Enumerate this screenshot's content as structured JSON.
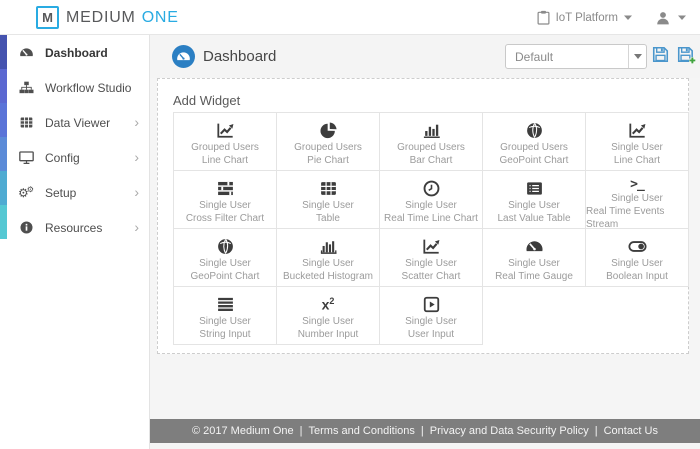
{
  "topbar": {
    "logo_letter": "M",
    "brand_part1": "MEDIUM",
    "brand_part2": "ONE",
    "project_menu": {
      "label": "IoT Platform",
      "icon": "clipboard-icon",
      "caret": "caret-down-icon"
    },
    "user_menu": {
      "icon": "user-icon",
      "caret": "caret-down-icon"
    }
  },
  "sidebar": {
    "chevron_glyph": "›",
    "items": [
      {
        "label": "Dashboard",
        "icon": "dashboard-gauge-icon",
        "active": true,
        "chevron": false
      },
      {
        "label": "Workflow Studio",
        "icon": "sitemap-icon",
        "active": false,
        "chevron": false
      },
      {
        "label": "Data Viewer",
        "icon": "table-icon",
        "active": false,
        "chevron": true
      },
      {
        "label": "Config",
        "icon": "desktop-icon",
        "active": false,
        "chevron": true
      },
      {
        "label": "Setup",
        "icon": "gears-icon",
        "active": false,
        "chevron": true
      },
      {
        "label": "Resources",
        "icon": "info-circle-icon",
        "active": false,
        "chevron": true
      }
    ],
    "accent_strip_colors": [
      "#4553af",
      "#5b68d1",
      "#5a74d8",
      "#5b8bd8",
      "#4fabd2",
      "#55c8d3"
    ]
  },
  "main_header": {
    "title": "Dashboard",
    "title_icon": "dashboard-gauge-icon",
    "dashboard_select": {
      "value": "Default"
    },
    "save_icon": "save-icon",
    "save_new_icon": "save-new-icon"
  },
  "add_widget": {
    "title": "Add Widget",
    "cards": [
      {
        "group": "Grouped Users",
        "name": "Line Chart",
        "icon": "line-chart-icon"
      },
      {
        "group": "Grouped Users",
        "name": "Pie Chart",
        "icon": "pie-chart-icon"
      },
      {
        "group": "Grouped Users",
        "name": "Bar Chart",
        "icon": "bar-chart-icon"
      },
      {
        "group": "Grouped Users",
        "name": "GeoPoint Chart",
        "icon": "globe-icon"
      },
      {
        "group": "Single User",
        "name": "Line Chart",
        "icon": "line-chart-icon"
      },
      {
        "group": "Single User",
        "name": "Cross Filter Chart",
        "icon": "cross-filter-icon"
      },
      {
        "group": "Single User",
        "name": "Table",
        "icon": "table-icon"
      },
      {
        "group": "Single User",
        "name": "Real Time Line Chart",
        "icon": "clock-icon"
      },
      {
        "group": "Single User",
        "name": "Last Value Table",
        "icon": "list-alt-icon"
      },
      {
        "group": "Single User",
        "name": "Real Time Events Stream",
        "icon": "terminal-icon"
      },
      {
        "group": "Single User",
        "name": "GeoPoint Chart",
        "icon": "globe-icon"
      },
      {
        "group": "Single User",
        "name": "Bucketed Histogram",
        "icon": "histogram-icon"
      },
      {
        "group": "Single User",
        "name": "Scatter Chart",
        "icon": "scatter-chart-icon"
      },
      {
        "group": "Single User",
        "name": "Real Time Gauge",
        "icon": "gauge-icon"
      },
      {
        "group": "Single User",
        "name": "Boolean Input",
        "icon": "toggle-on-icon"
      },
      {
        "group": "Single User",
        "name": "String Input",
        "icon": "justify-lines-icon"
      },
      {
        "group": "Single User",
        "name": "Number Input",
        "icon": "x-squared-icon"
      },
      {
        "group": "Single User",
        "name": "User Input",
        "icon": "play-square-icon"
      }
    ]
  },
  "footer": {
    "copyright": "© 2017 Medium One",
    "separator": "|",
    "links": [
      "Terms and Conditions",
      "Privacy and Data Security Policy",
      "Contact Us"
    ]
  },
  "colors": {
    "accent_blue": "#29abe2",
    "title_icon_blue": "#2b7fc3",
    "save_icon_blue": "#4a96cc",
    "save_plus_green": "#41a33f",
    "footer_bg": "#7e7e7e"
  }
}
